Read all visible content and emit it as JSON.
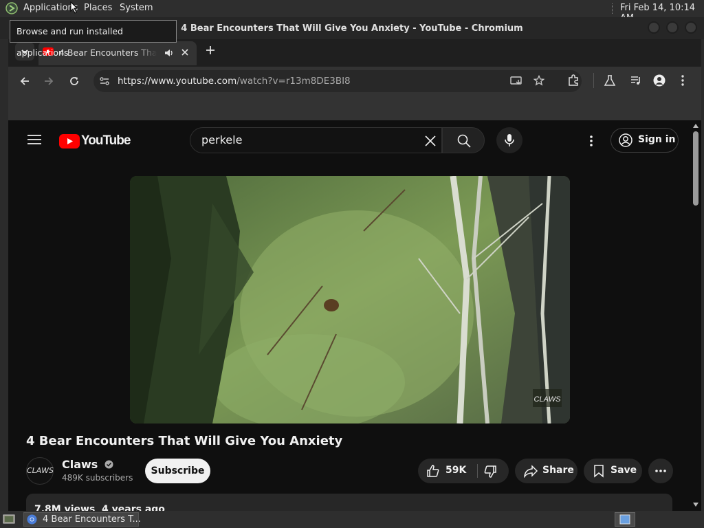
{
  "top_panel": {
    "menus": [
      "Applications",
      "Places",
      "System"
    ],
    "clock": "Fri Feb 14, 10:14 AM"
  },
  "tooltip": "Browse and run installed applications",
  "window": {
    "title": "4 Bear Encounters That Will Give You Anxiety - YouTube - Chromium"
  },
  "browser": {
    "tab_title": "4 Bear Encounters That Will Give You Anxiety",
    "url_host": "https://www.youtube.com",
    "url_path": "/watch?v=r13m8DE3BI8"
  },
  "youtube": {
    "logo_text": "YouTube",
    "search_value": "perkele",
    "sign_in": "Sign in",
    "video_title": "4 Bear Encounters That Will Give You Anxiety",
    "watermark": "CLAWS",
    "channel_name": "Claws",
    "channel_avatar": "CLAWS",
    "subscribers": "489K subscribers",
    "subscribe": "Subscribe",
    "likes": "59K",
    "share": "Share",
    "save": "Save",
    "description_preview": "7.8M views  4 years ago"
  },
  "taskbar": {
    "item_label": "4 Bear Encounters T..."
  },
  "colors": {
    "youtube_red": "#ff0000",
    "page_bg": "#0f0f0f",
    "button_bg": "#272727"
  }
}
